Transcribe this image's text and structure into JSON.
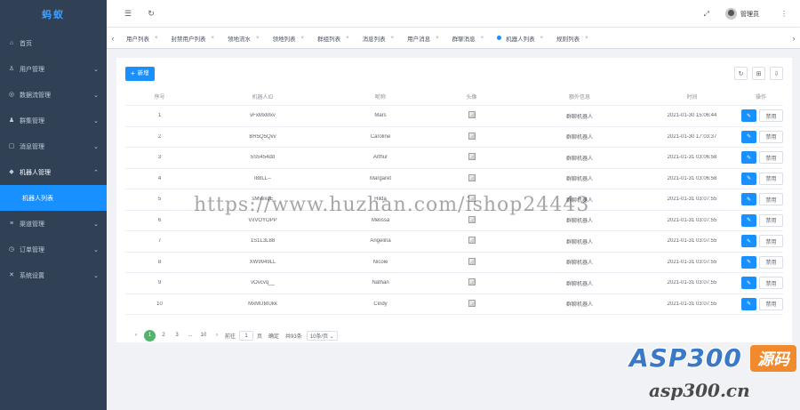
{
  "app": {
    "brand": "蚂蚁"
  },
  "sidebar": {
    "items": [
      {
        "label": "首页",
        "icon": "home-icon",
        "glyph": "⌂"
      },
      {
        "label": "用户管理",
        "icon": "user-icon",
        "glyph": "♙",
        "chevron": "⌄"
      },
      {
        "label": "数据流管理",
        "icon": "dataflow-icon",
        "glyph": "◎",
        "chevron": "⌄"
      },
      {
        "label": "群集管理",
        "icon": "group-icon",
        "glyph": "♟",
        "chevron": "⌄"
      },
      {
        "label": "消息管理",
        "icon": "message-icon",
        "glyph": "▢",
        "chevron": "⌄"
      },
      {
        "label": "机器人管理",
        "icon": "robot-icon",
        "glyph": "◆",
        "chevron": "⌃",
        "open": true
      },
      {
        "label": "渠道管理",
        "icon": "channel-icon",
        "glyph": "≡",
        "chevron": "⌄"
      },
      {
        "label": "订单管理",
        "icon": "order-icon",
        "glyph": "◷",
        "chevron": "⌄"
      },
      {
        "label": "系统设置",
        "icon": "settings-icon",
        "glyph": "✕",
        "chevron": "⌄"
      }
    ],
    "sub_item": "机器人列表"
  },
  "navbar": {
    "hamburger": "☰",
    "refresh": "↻",
    "fullscreen": "⤢",
    "user_name": "管理员",
    "more": "⋮"
  },
  "tabs": {
    "left_arrow": "‹",
    "right_arrow": "›",
    "close": "×",
    "items": [
      "用户列表",
      "封禁用户列表",
      "领地流水",
      "领地列表",
      "群组列表",
      "消息列表",
      "用户消息",
      "群聊消息",
      "机器人列表",
      "规则列表"
    ],
    "active_index": 8
  },
  "toolbar": {
    "add_label": "新增",
    "add_plus": "+",
    "icons": [
      {
        "name": "refresh-icon",
        "glyph": "↻"
      },
      {
        "name": "columns-icon",
        "glyph": "⊞"
      },
      {
        "name": "export-icon",
        "glyph": "⇩"
      }
    ]
  },
  "table": {
    "headers": [
      "序号",
      "机器人ID",
      "昵称",
      "头像",
      "额外信息",
      "时间",
      "操作"
    ],
    "rows": [
      {
        "no": "1",
        "id": "vFxMxMxv",
        "nick": "Mars",
        "type": "群聊机器人",
        "time": "2021-01-30 15:06:44"
      },
      {
        "no": "2",
        "id": "BR5Q5Qvv",
        "nick": "Caroline",
        "type": "群聊机器人",
        "time": "2021-01-30 17:03:37"
      },
      {
        "no": "3",
        "id": "5S5454dd",
        "nick": "Arthur",
        "type": "群聊机器人",
        "time": "2021-01-31 03:06:58"
      },
      {
        "no": "4",
        "id": "I88LL--",
        "nick": "Margaret",
        "type": "群聊机器人",
        "time": "2021-01-31 03:06:58"
      },
      {
        "no": "5",
        "id": "sMvvxqE",
        "nick": "Hilda",
        "type": "群聊机器人",
        "time": "2021-01-31 03:07:55"
      },
      {
        "no": "6",
        "id": "VxVOYOPP",
        "nick": "Melissa",
        "type": "群聊机器人",
        "time": "2021-01-31 03:07:55"
      },
      {
        "no": "7",
        "id": "1S1L3L88",
        "nick": "Angelina",
        "type": "群聊机器人",
        "time": "2021-01-31 03:07:55"
      },
      {
        "no": "8",
        "id": "XW9949LL",
        "nick": "Nicole",
        "type": "群聊机器人",
        "time": "2021-01-31 03:07:55"
      },
      {
        "no": "9",
        "id": "vOvcvq__",
        "nick": "Nathan",
        "type": "群聊机器人",
        "time": "2021-01-31 03:07:55"
      },
      {
        "no": "10",
        "id": "MxMUMUkk",
        "nick": "Cindy",
        "type": "群聊机器人",
        "time": "2021-01-31 03:07:55"
      }
    ],
    "edit_glyph": "✎",
    "disable_label": "禁用"
  },
  "pagination": {
    "prev": "‹",
    "pages": [
      "1",
      "2",
      "3",
      "...",
      "10"
    ],
    "active": "1",
    "next": "›",
    "goto_label": "前往",
    "goto_value": "1",
    "page_unit": "页",
    "confirm": "确定",
    "total": "共93条",
    "page_size": "10条/页 ⌄"
  },
  "overlay": {
    "watermark": "https://www.huzhan.com/ishop24443",
    "logo_main": "ASP300",
    "logo_badge": "源码",
    "logo_sub": "asp300.cn"
  },
  "colors": {
    "sidebar_bg": "#304156",
    "primary": "#1890ff",
    "pager_active": "#52b36b"
  }
}
